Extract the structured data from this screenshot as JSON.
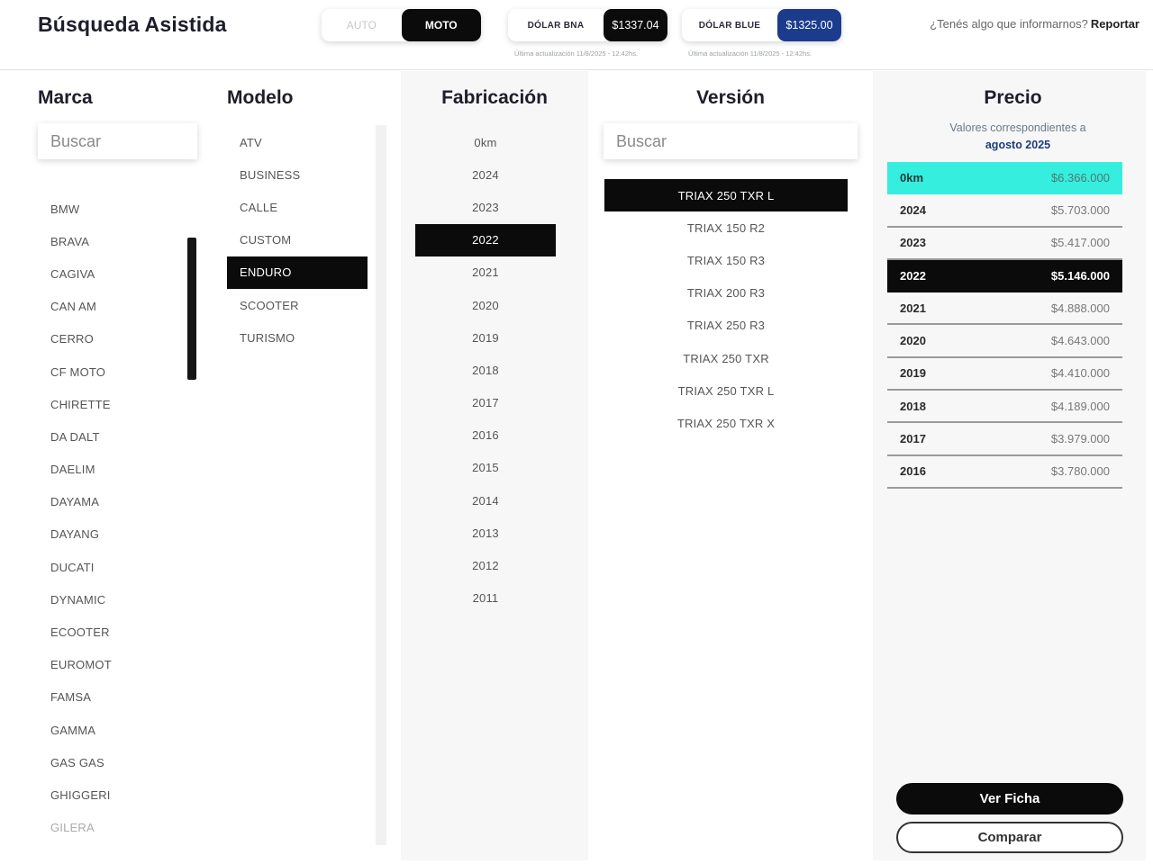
{
  "header": {
    "title": "Búsqueda Asistida",
    "vehicle_toggle": {
      "options": [
        "AUTO",
        "MOTO"
      ],
      "selected": "MOTO"
    },
    "rates": [
      {
        "label": "DÓLAR BNA",
        "value": "$1337.04",
        "updated": "Última actualización 11/8/2025 - 12:42hs.",
        "color": "#0b0b0b"
      },
      {
        "label": "DÓLAR BLUE",
        "value": "$1325.00",
        "updated": "Última actualización 11/8/2025 - 12:42hs.",
        "color": "#1b3c8c"
      }
    ],
    "report_prompt": "¿Tenés algo que informarnos?",
    "report_link": "Reportar"
  },
  "marca": {
    "title": "Marca",
    "search_placeholder": "Buscar",
    "items": [
      "BMW",
      "BRAVA",
      "CAGIVA",
      "CAN AM",
      "CERRO",
      "CF MOTO",
      "CHIRETTE",
      "DA DALT",
      "DAELIM",
      "DAYAMA",
      "DAYANG",
      "DUCATI",
      "DYNAMIC",
      "ECOOTER",
      "EUROMOT",
      "FAMSA",
      "GAMMA",
      "GAS GAS",
      "GHIGGERI",
      "GILERA"
    ]
  },
  "modelo": {
    "title": "Modelo",
    "items": [
      "ATV",
      "BUSINESS",
      "CALLE",
      "CUSTOM",
      "ENDURO",
      "SCOOTER",
      "TURISMO"
    ],
    "selected": "ENDURO"
  },
  "fabricacion": {
    "title": "Fabricación",
    "items": [
      "0km",
      "2024",
      "2023",
      "2022",
      "2021",
      "2020",
      "2019",
      "2018",
      "2017",
      "2016",
      "2015",
      "2014",
      "2013",
      "2012",
      "2011"
    ],
    "selected": "2022"
  },
  "version": {
    "title": "Versión",
    "search_placeholder": "Buscar",
    "items": [
      "TRIAX 250 TXR L",
      "TRIAX 150 R2",
      "TRIAX 150 R3",
      "TRIAX 200 R3",
      "TRIAX 250 R3",
      "TRIAX 250 TXR",
      "TRIAX 250 TXR L",
      "TRIAX 250 TXR X"
    ],
    "selected_index": 0
  },
  "precio": {
    "title": "Precio",
    "subtitle": "Valores correspondientes a",
    "month": "agosto 2025",
    "rows": [
      {
        "year": "0km",
        "price": "$6.366.000"
      },
      {
        "year": "2024",
        "price": "$5.703.000"
      },
      {
        "year": "2023",
        "price": "$5.417.000"
      },
      {
        "year": "2022",
        "price": "$5.146.000"
      },
      {
        "year": "2021",
        "price": "$4.888.000"
      },
      {
        "year": "2020",
        "price": "$4.643.000"
      },
      {
        "year": "2019",
        "price": "$4.410.000"
      },
      {
        "year": "2018",
        "price": "$4.189.000"
      },
      {
        "year": "2017",
        "price": "$3.979.000"
      },
      {
        "year": "2016",
        "price": "$3.780.000"
      }
    ],
    "selected_year": "2022",
    "new_highlight_color": "#36eedd",
    "ficha_label": "Ver Ficha",
    "compare_label": "Comparar"
  }
}
